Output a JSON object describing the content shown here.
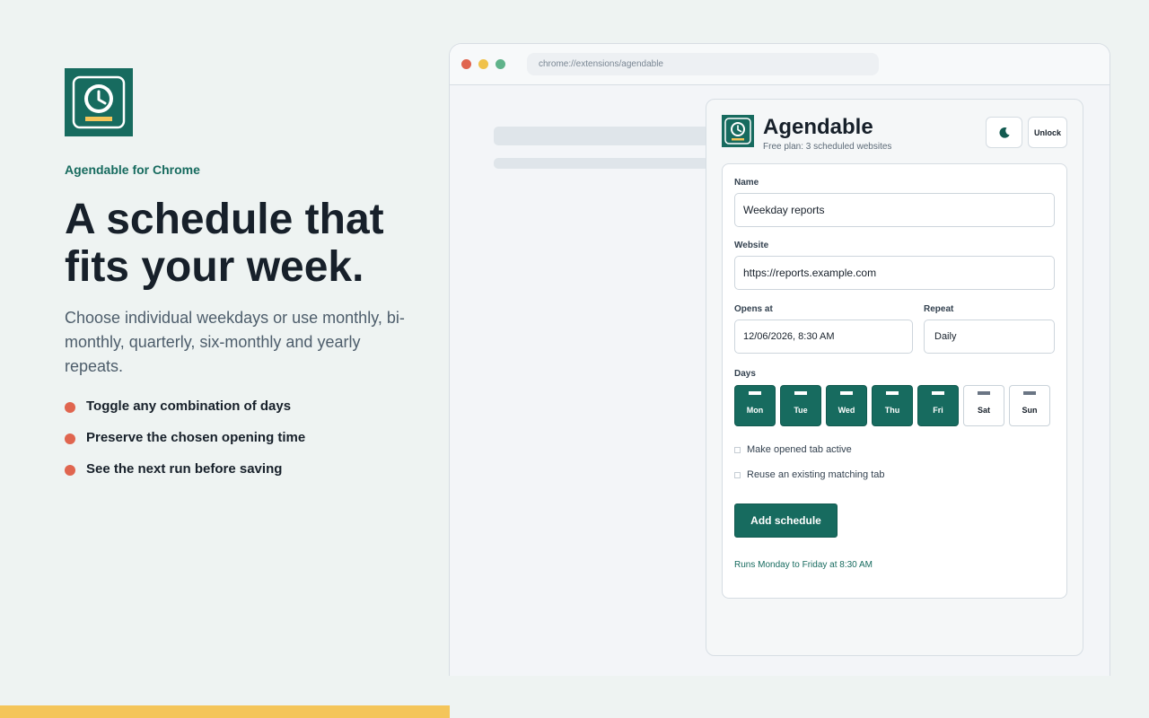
{
  "hero": {
    "brand": "Agendable for Chrome",
    "headline_line1": "A schedule that",
    "headline_line2": "fits your week.",
    "lead": "Choose individual weekdays or use monthly, bi-monthly, quarterly, six-monthly and yearly repeats.",
    "bullets": [
      "Toggle any combination of days",
      "Preserve the chosen opening time",
      "See the next run before saving"
    ]
  },
  "browser": {
    "url": "chrome://extensions/agendable"
  },
  "popup": {
    "title": "Agendable",
    "subtitle": "Free plan: 3 scheduled websites",
    "theme_icon": "moon-icon",
    "unlock_label": "Unlock",
    "form": {
      "name_label": "Name",
      "name_value": "Weekday reports",
      "website_label": "Website",
      "website_value": "https://reports.example.com",
      "opens_label": "Opens at",
      "opens_value": "12/06/2026, 8:30 AM",
      "repeat_label": "Repeat",
      "repeat_value": "Daily",
      "days_label": "Days",
      "days": [
        {
          "label": "Mon",
          "selected": true
        },
        {
          "label": "Tue",
          "selected": true
        },
        {
          "label": "Wed",
          "selected": true
        },
        {
          "label": "Thu",
          "selected": true
        },
        {
          "label": "Fri",
          "selected": true
        },
        {
          "label": "Sat",
          "selected": false
        },
        {
          "label": "Sun",
          "selected": false
        }
      ],
      "check_active": "Make opened tab active",
      "check_reuse": "Reuse an existing matching tab",
      "submit_label": "Add schedule",
      "runs_text": "Runs Monday to Friday at 8:30 AM"
    }
  },
  "colors": {
    "brand": "#176b5f",
    "accent": "#f4c55a",
    "bullet": "#e0654f"
  }
}
